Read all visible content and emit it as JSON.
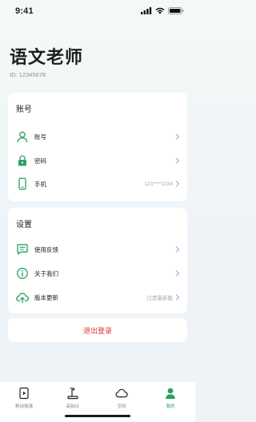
{
  "status_bar": {
    "time": "9:41"
  },
  "profile": {
    "name": "语文老师",
    "id_text": "ID: 12345678"
  },
  "account_section": {
    "title": "账号",
    "items": [
      {
        "label": "账号",
        "value": "",
        "icon": "user-icon"
      },
      {
        "label": "密码",
        "value": "",
        "icon": "lock-icon"
      },
      {
        "label": "手机",
        "value": "123****1234",
        "icon": "phone-icon"
      }
    ]
  },
  "settings_section": {
    "title": "设置",
    "items": [
      {
        "label": "使用反馈",
        "value": "",
        "icon": "feedback-icon"
      },
      {
        "label": "关于我们",
        "value": "",
        "icon": "info-icon"
      },
      {
        "label": "版本更新",
        "value": "已是最新版",
        "icon": "cloud-upload-icon"
      }
    ]
  },
  "logout": {
    "label": "退出登录"
  },
  "tabbar": {
    "tabs": [
      {
        "label": "移动授课",
        "icon": "mobile-teaching-icon",
        "active": false
      },
      {
        "label": "高拍仪",
        "icon": "document-camera-icon",
        "active": false
      },
      {
        "label": "空间",
        "icon": "cloud-icon",
        "active": false
      },
      {
        "label": "我的",
        "icon": "person-icon",
        "active": true
      }
    ]
  },
  "colors": {
    "accent": "#2aa061",
    "danger": "#e03434"
  }
}
